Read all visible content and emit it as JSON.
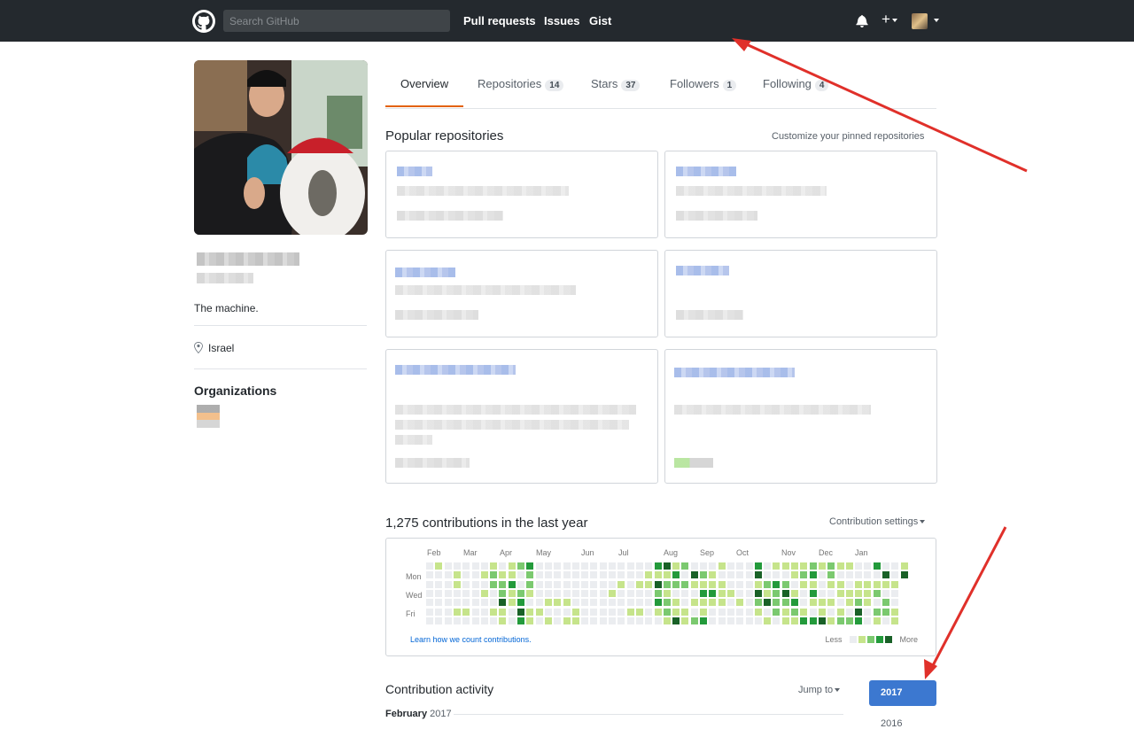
{
  "header": {
    "search_placeholder": "Search GitHub",
    "nav": [
      "Pull requests",
      "Issues",
      "Gist"
    ],
    "plus": "+"
  },
  "profile": {
    "bio": "The machine.",
    "location": "Israel",
    "organizations_heading": "Organizations"
  },
  "tabs": [
    {
      "label": "Overview",
      "count": ""
    },
    {
      "label": "Repositories",
      "count": "14"
    },
    {
      "label": "Stars",
      "count": "37"
    },
    {
      "label": "Followers",
      "count": "1"
    },
    {
      "label": "Following",
      "count": "4"
    }
  ],
  "popular": {
    "heading": "Popular repositories",
    "customize": "Customize your pinned repositories"
  },
  "contributions": {
    "heading": "1,275 contributions in the last year",
    "settings": "Contribution settings",
    "months": [
      "Feb",
      "Mar",
      "Apr",
      "May",
      "Jun",
      "Jul",
      "Aug",
      "Sep",
      "Oct",
      "Nov",
      "Dec",
      "Jan"
    ],
    "days": [
      "Mon",
      "Wed",
      "Fri"
    ],
    "learn": "Learn how we count contributions.",
    "less": "Less",
    "more": "More",
    "colors": [
      "#ebedf0",
      "#c6e48b",
      "#7bc96f",
      "#239a3b",
      "#196127"
    ]
  },
  "activity": {
    "heading": "Contribution activity",
    "jump": "Jump to",
    "month_bold": "February",
    "month_year": "2017",
    "years": [
      "2017",
      "2016"
    ]
  }
}
